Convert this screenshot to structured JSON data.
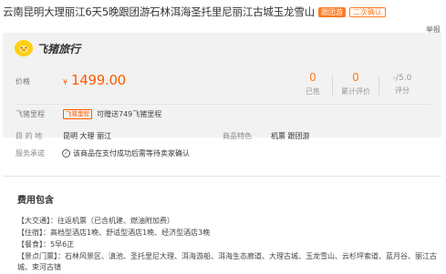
{
  "header": {
    "title": "云南昆明大理丽江6天5晚跟团游石林洱海圣托里尼丽江古城玉龙雪山",
    "badge_primary": "跟团游",
    "badge_secondary": "二次确认",
    "report_label": "举报"
  },
  "panel": {
    "logo_text": "飞猪旅行",
    "price_label": "价格",
    "currency": "¥",
    "price": "1499.00",
    "stats": [
      {
        "value": "0",
        "label": "已售"
      },
      {
        "value": "0",
        "label": "累计评价"
      },
      {
        "value": "-/5.0",
        "label": "评分"
      }
    ],
    "miles_label": "飞猪里程",
    "miles_tag": "飞猪里程",
    "miles_text": "可赠送749飞猪里程"
  },
  "info": {
    "destination_label": "目 的 地",
    "destination_value": "昆明  大理  丽江",
    "feature_label": "商品特色",
    "feature_value": "机票  跟团游",
    "service_label": "服务承诺",
    "service_value": "该商品在支付成功后需等待卖家确认"
  },
  "fees": {
    "title": "费用包含",
    "lines": [
      "【大交通】：往返机票（已含机建、燃油附加费）",
      "【住宿】：高档型酒店1晚、舒适型酒店1晚、经济型酒店3晚",
      "【餐食】：5早6正",
      "【景点门票】：石林风景区、滇池、圣托里尼大理、洱海游船、洱海生态廊道、大理古城、玉龙雪山、云杉坪索道、蓝月谷、丽江古城、束河古镇"
    ]
  },
  "colors": {
    "accent": "#ff7a22",
    "price": "#ff5a00",
    "panel_bg": "#f2f2f2",
    "logo_yellow": "#ffcf14"
  }
}
